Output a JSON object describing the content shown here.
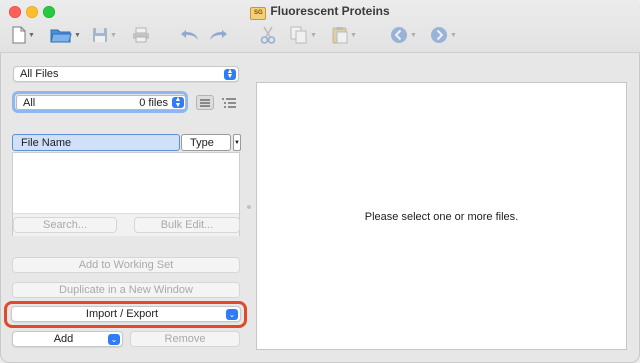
{
  "window": {
    "title": "Fluorescent Proteins",
    "doc_badge": "SG"
  },
  "toolbar": {
    "items": [
      {
        "name": "new-document-icon",
        "has_menu": true
      },
      {
        "name": "open-folder-icon",
        "has_menu": true
      },
      {
        "name": "save-icon",
        "has_menu": true
      },
      {
        "name": "print-icon",
        "has_menu": false
      },
      {
        "name": "undo-icon",
        "has_menu": false
      },
      {
        "name": "redo-icon",
        "has_menu": false
      },
      {
        "name": "cut-icon",
        "has_menu": false
      },
      {
        "name": "copy-icon",
        "has_menu": true
      },
      {
        "name": "paste-icon",
        "has_menu": true
      },
      {
        "name": "back-icon",
        "has_menu": true
      },
      {
        "name": "forward-icon",
        "has_menu": true
      }
    ]
  },
  "sidebar": {
    "scope_select": "All Files",
    "filter": {
      "value": "All",
      "count": "0 files"
    },
    "columns": {
      "file_name": "File Name",
      "type": "Type"
    },
    "search_button": "Search...",
    "bulk_edit_button": "Bulk Edit...",
    "add_to_working_set": "Add to Working Set",
    "duplicate_window": "Duplicate in a New Window",
    "import_export": "Import / Export",
    "add_select": "Add",
    "remove_button": "Remove"
  },
  "preview": {
    "message": "Please select one or more files."
  },
  "colors": {
    "accent": "#2f7cf6",
    "highlight_ring": "#e04a2b",
    "focus_ring": "#8fb7ef",
    "header_selected": "#cfe0f8"
  }
}
